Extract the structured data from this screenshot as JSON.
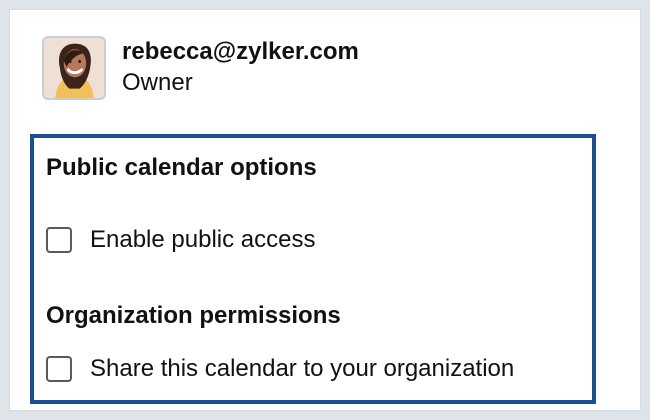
{
  "owner": {
    "email": "rebecca@zylker.com",
    "role": "Owner",
    "avatar_icon": "user-avatar-photo"
  },
  "public_calendar": {
    "title": "Public calendar options",
    "enable_public_access_label": "Enable public access",
    "enable_public_access_checked": false
  },
  "organization": {
    "title": "Organization permissions",
    "share_label": "Share this calendar to your organization",
    "share_checked": false
  },
  "colors": {
    "highlight_border": "#1c4f8d",
    "background": "#dfe4ea",
    "checkbox_border": "#555a60"
  }
}
